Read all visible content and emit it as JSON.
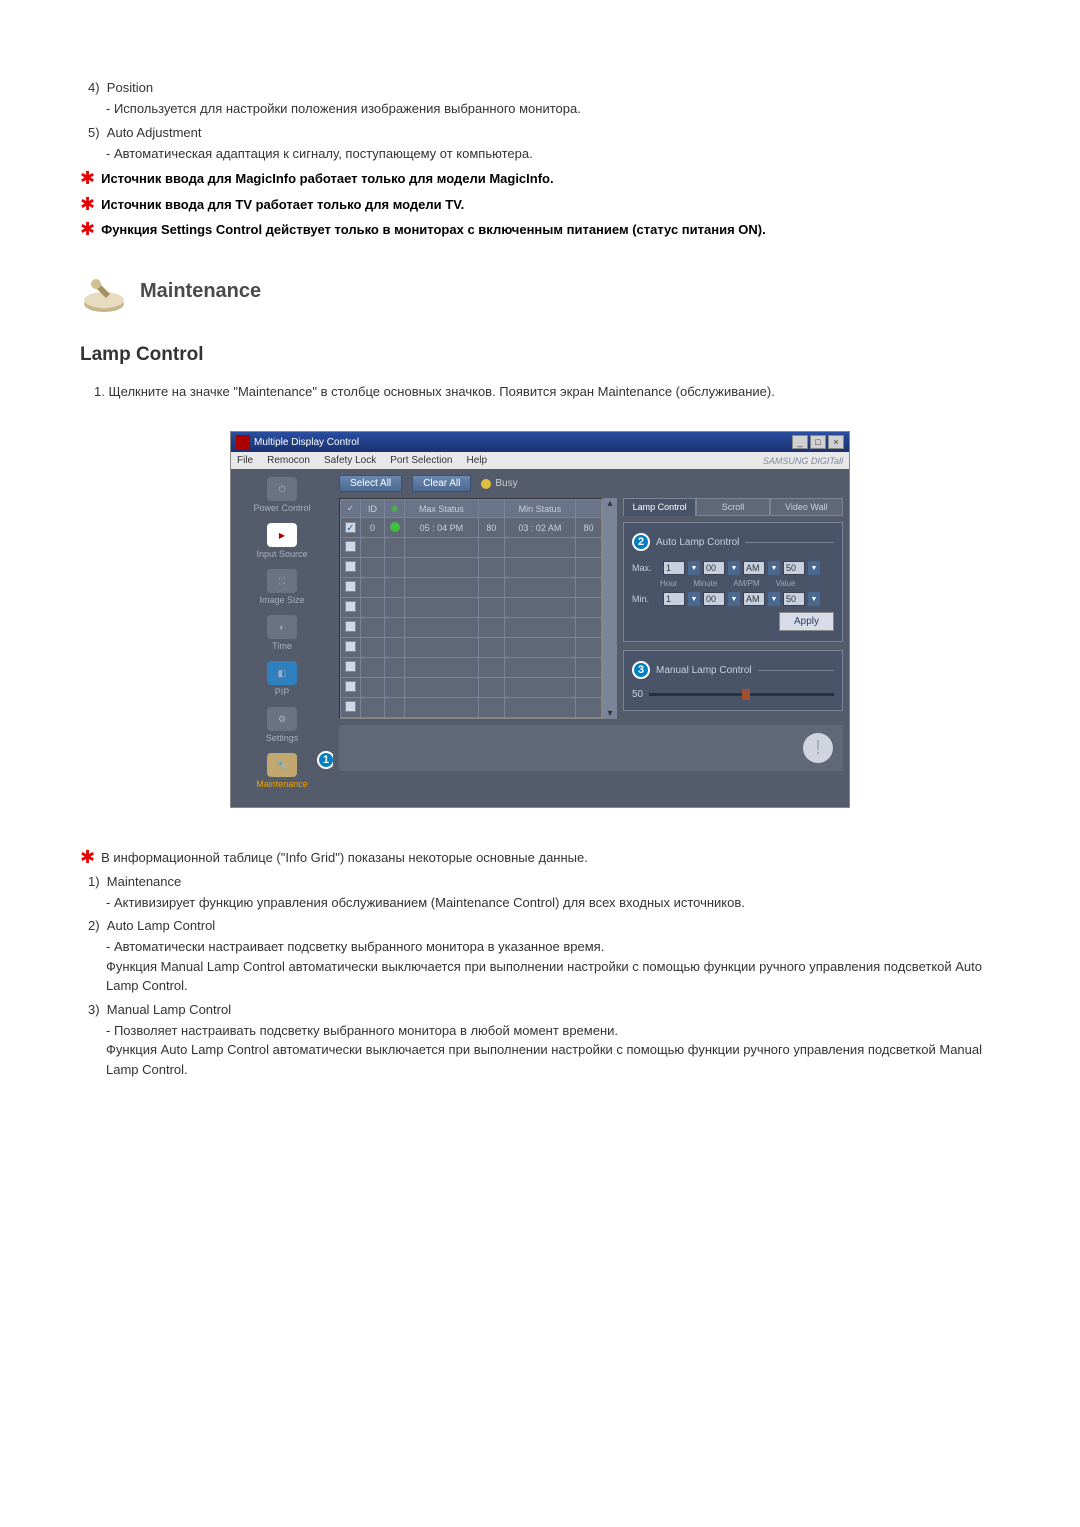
{
  "top_items": [
    {
      "num": "4)",
      "title": "Position",
      "dash": "- Используется для настройки положения изображения выбранного монитора."
    },
    {
      "num": "5)",
      "title": "Auto Adjustment",
      "dash": "- Автоматическая адаптация к сигналу, поступающему от компьютера."
    }
  ],
  "star_notes_top": [
    "Источник ввода для MagicInfo работает только для модели MagicInfo.",
    "Источник ввода для TV работает только для модели TV.",
    "Функция Settings Control действует только в мониторах с включенным питанием (статус питания ON)."
  ],
  "section_title": "Maintenance",
  "subsection_title": "Lamp Control",
  "numbered_intro": "1.  Щелкните на значке \"Maintenance\" в столбце основных значков. Появится экран Maintenance (обслуживание).",
  "app": {
    "title": "Multiple Display Control",
    "menus": [
      "File",
      "Remocon",
      "Safety Lock",
      "Port Selection",
      "Help"
    ],
    "logo": "SAMSUNG DIGITall",
    "select_all": "Select All",
    "clear_all": "Clear All",
    "busy": "Busy",
    "sidebar": [
      {
        "label": "Power Control"
      },
      {
        "label": "Input Source"
      },
      {
        "label": "Image Size"
      },
      {
        "label": "Time"
      },
      {
        "label": "PIP"
      },
      {
        "label": "Settings"
      },
      {
        "label": "Maintenance"
      }
    ],
    "marker1": "1",
    "grid_headers": {
      "chk": "✓",
      "id": "ID",
      "led": "",
      "max": "Max Status",
      "maxv": "",
      "min": "Min Status",
      "minv": ""
    },
    "grid_row": {
      "id": "0",
      "max_time": "05 : 04 PM",
      "max_val": "80",
      "min_time": "03 : 02 AM",
      "min_val": "80"
    },
    "tabs": [
      "Lamp Control",
      "Scroll",
      "Video Wall"
    ],
    "auto_panel": {
      "marker": "2",
      "title": "Auto Lamp Control",
      "max_label": "Max.",
      "min_label": "Min.",
      "hour_hint": "Hour",
      "minute_hint": "Minute",
      "ampm_hint": "AM/PM",
      "value_hint": "Value",
      "h1": "1",
      "m1": "00",
      "ap1": "AM",
      "v1": "50",
      "h2": "1",
      "m2": "00",
      "ap2": "AM",
      "v2": "50",
      "apply": "Apply"
    },
    "manual_panel": {
      "marker": "3",
      "title": "Manual Lamp Control",
      "value": "50"
    }
  },
  "star_note_mid": "В информационной таблице (\"Info Grid\") показаны некоторые основные данные.",
  "post_items": [
    {
      "num": "1)",
      "title": "Maintenance",
      "dash": "- Активизирует функцию управления обслуживанием (Maintenance Control) для всех входных источников."
    },
    {
      "num": "2)",
      "title": "Auto Lamp Control",
      "dash": "- Автоматически настраивает подсветку выбранного монитора в указанное время.\nФункция Manual Lamp Control автоматически выключается при выполнении настройки с помощью функции ручного управления подсветкой Auto Lamp Control."
    },
    {
      "num": "3)",
      "title": "Manual Lamp Control",
      "dash": "- Позволяет настраивать подсветку выбранного монитора в любой момент времени.\nФункция Auto Lamp Control автоматически выключается при выполнении настройки с помощью функции ручного управления подсветкой Manual Lamp Control."
    }
  ]
}
